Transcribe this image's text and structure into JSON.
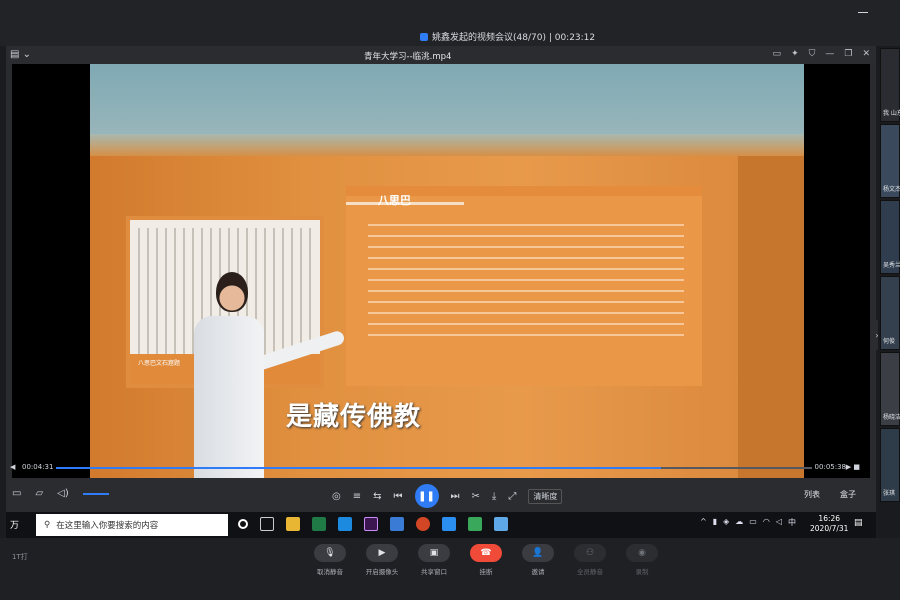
{
  "meeting": {
    "title": "姚鑫发起的视频会议(48/70) | 00:23:12"
  },
  "player": {
    "file_name": "青年大学习--临洮.mp4",
    "current_time": "00:04:31",
    "total_time": "00:05:38",
    "progress_fraction": 0.8,
    "clarity_label": "清晰度",
    "playlist_label": "列表",
    "box_label": "盒子",
    "video": {
      "exhibit_title": "八思巴",
      "panel_caption": "八思巴文石窟题",
      "subtitle": "是藏传佛教"
    }
  },
  "taskbar": {
    "start_label": "万",
    "search_placeholder": "在这里输入你要搜索的内容",
    "ime_label": "中",
    "time": "16:26",
    "date": "2020/7/31"
  },
  "meeting_controls": {
    "left_label": "1T打",
    "buttons": [
      {
        "label": "取消静音",
        "icon": "mic-muted-icon"
      },
      {
        "label": "开启摄像头",
        "icon": "camera-icon"
      },
      {
        "label": "共享窗口",
        "icon": "share-window-icon"
      },
      {
        "label": "挂断",
        "icon": "hangup-icon"
      },
      {
        "label": "邀请",
        "icon": "invite-icon"
      },
      {
        "label": "全员静音",
        "icon": "mute-all-icon"
      },
      {
        "label": "录制",
        "icon": "record-icon"
      }
    ]
  },
  "participants": [
    {
      "name": "我 山东大"
    },
    {
      "name": "杨文杰"
    },
    {
      "name": "吴秀兰"
    },
    {
      "name": "何俊"
    },
    {
      "name": "杨晓洁"
    },
    {
      "name": "张琪"
    }
  ],
  "colors": {
    "accent": "#2f7cf6",
    "hangup": "#f04a38"
  }
}
